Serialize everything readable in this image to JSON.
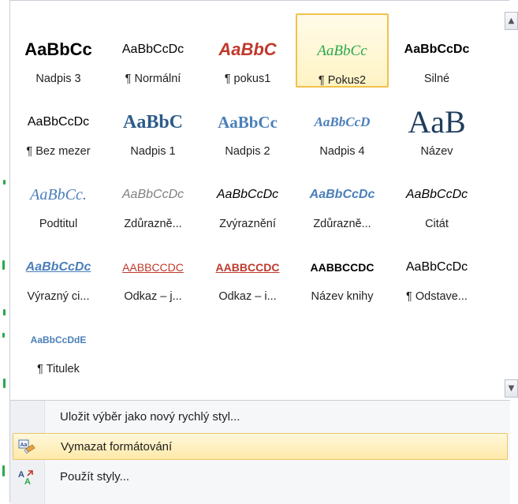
{
  "sample_text": "AaBbCcDdEe",
  "styles": [
    {
      "label": "Nadpis 3",
      "sample": "AaBbCc",
      "pilcrow": false,
      "font": "Liberation Sans",
      "size": 22,
      "weight": "bold",
      "italic": false,
      "color": "#000000",
      "caps": false,
      "underline": false
    },
    {
      "label": "Normální",
      "sample": "AaBbCcDc",
      "pilcrow": true,
      "font": "Liberation Sans",
      "size": 16,
      "weight": "normal",
      "italic": false,
      "color": "#000000",
      "caps": false,
      "underline": false
    },
    {
      "label": "pokus1",
      "sample": "AaBbC",
      "pilcrow": true,
      "font": "Liberation Sans",
      "size": 22,
      "weight": "bold",
      "italic": true,
      "color": "#c0392b",
      "caps": false,
      "underline": false
    },
    {
      "label": "Pokus2",
      "sample": "AaBbCc",
      "pilcrow": true,
      "font": "Liberation Serif",
      "size": 19,
      "weight": "normal",
      "italic": true,
      "color": "#2aa84a",
      "caps": false,
      "underline": false
    },
    {
      "label": "Silné",
      "sample": "AaBbCcDc",
      "pilcrow": false,
      "font": "Liberation Sans",
      "size": 16,
      "weight": "bold",
      "italic": false,
      "color": "#000000",
      "caps": false,
      "underline": false
    },
    {
      "label": "Bez mezer",
      "sample": "AaBbCcDc",
      "pilcrow": true,
      "font": "Liberation Sans",
      "size": 16,
      "weight": "normal",
      "italic": false,
      "color": "#000000",
      "caps": false,
      "underline": false
    },
    {
      "label": "Nadpis 1",
      "sample": "AaBbC",
      "pilcrow": false,
      "font": "Liberation Serif",
      "size": 24,
      "weight": "bold",
      "italic": false,
      "color": "#2d5b8a",
      "caps": false,
      "underline": false
    },
    {
      "label": "Nadpis 2",
      "sample": "AaBbCc",
      "pilcrow": false,
      "font": "Liberation Serif",
      "size": 21,
      "weight": "bold",
      "italic": false,
      "color": "#4a7fb9",
      "caps": false,
      "underline": false
    },
    {
      "label": "Nadpis 4",
      "sample": "AaBbCcD",
      "pilcrow": false,
      "font": "Liberation Serif",
      "size": 17,
      "weight": "bold",
      "italic": true,
      "color": "#4a7fb9",
      "caps": false,
      "underline": false
    },
    {
      "label": "Název",
      "sample": "AaB",
      "pilcrow": false,
      "font": "Liberation Serif",
      "size": 40,
      "weight": "normal",
      "italic": false,
      "color": "#1f3d5c",
      "caps": false,
      "underline": false
    },
    {
      "label": "Podtitul",
      "sample": "AaBbCc.",
      "pilcrow": false,
      "font": "Liberation Serif",
      "size": 20,
      "weight": "normal",
      "italic": true,
      "color": "#4a7fb9",
      "caps": false,
      "underline": false
    },
    {
      "label": "Zdůrazně...",
      "sample": "AaBbCcDc",
      "pilcrow": false,
      "font": "Liberation Sans",
      "size": 16,
      "weight": "normal",
      "italic": true,
      "color": "#808080",
      "caps": false,
      "underline": false
    },
    {
      "label": "Zvýraznění",
      "sample": "AaBbCcDc",
      "pilcrow": false,
      "font": "Liberation Sans",
      "size": 16,
      "weight": "normal",
      "italic": true,
      "color": "#000000",
      "caps": false,
      "underline": false
    },
    {
      "label": "Zdůrazně...",
      "sample": "AaBbCcDc",
      "pilcrow": false,
      "font": "Liberation Sans",
      "size": 16,
      "weight": "bold",
      "italic": true,
      "color": "#4a7fb9",
      "caps": false,
      "underline": false
    },
    {
      "label": "Citát",
      "sample": "AaBbCcDc",
      "pilcrow": false,
      "font": "Liberation Sans",
      "size": 16,
      "weight": "normal",
      "italic": true,
      "color": "#000000",
      "caps": false,
      "underline": false
    },
    {
      "label": "Výrazný ci...",
      "sample": "AaBbCcDc",
      "pilcrow": false,
      "font": "Liberation Sans",
      "size": 16,
      "weight": "bold",
      "italic": true,
      "color": "#4a7fb9",
      "caps": false,
      "underline": true
    },
    {
      "label": "Odkaz – j...",
      "sample": "AaBbCcDc",
      "pilcrow": false,
      "font": "Liberation Sans",
      "size": 14,
      "weight": "normal",
      "italic": false,
      "color": "#c0392b",
      "caps": true,
      "underline": true
    },
    {
      "label": "Odkaz – i...",
      "sample": "AaBbCcDc",
      "pilcrow": false,
      "font": "Liberation Sans",
      "size": 14,
      "weight": "bold",
      "italic": false,
      "color": "#c0392b",
      "caps": true,
      "underline": true
    },
    {
      "label": "Název knihy",
      "sample": "AaBbCcDc",
      "pilcrow": false,
      "font": "Liberation Sans",
      "size": 14,
      "weight": "bold",
      "italic": false,
      "color": "#000000",
      "caps": true,
      "underline": false
    },
    {
      "label": "Odstave...",
      "sample": "AaBbCcDc",
      "pilcrow": true,
      "font": "Liberation Sans",
      "size": 16,
      "weight": "normal",
      "italic": false,
      "color": "#000000",
      "caps": false,
      "underline": false
    },
    {
      "label": "Titulek",
      "sample": "AaBbCcDdE",
      "pilcrow": true,
      "font": "Liberation Sans",
      "size": 12,
      "weight": "bold",
      "italic": false,
      "color": "#4a7fb9",
      "caps": false,
      "underline": false
    }
  ],
  "selected_style": "Pokus2",
  "menu": {
    "save_selection": "Uložit výběr jako nový rychlý styl...",
    "clear_formatting": "Vymazat formátování",
    "apply_styles": "Použít styly..."
  },
  "colors": {
    "selected_border": "#f0c24c",
    "hover_border": "#e8c468",
    "accent_green": "#2aa84a"
  }
}
